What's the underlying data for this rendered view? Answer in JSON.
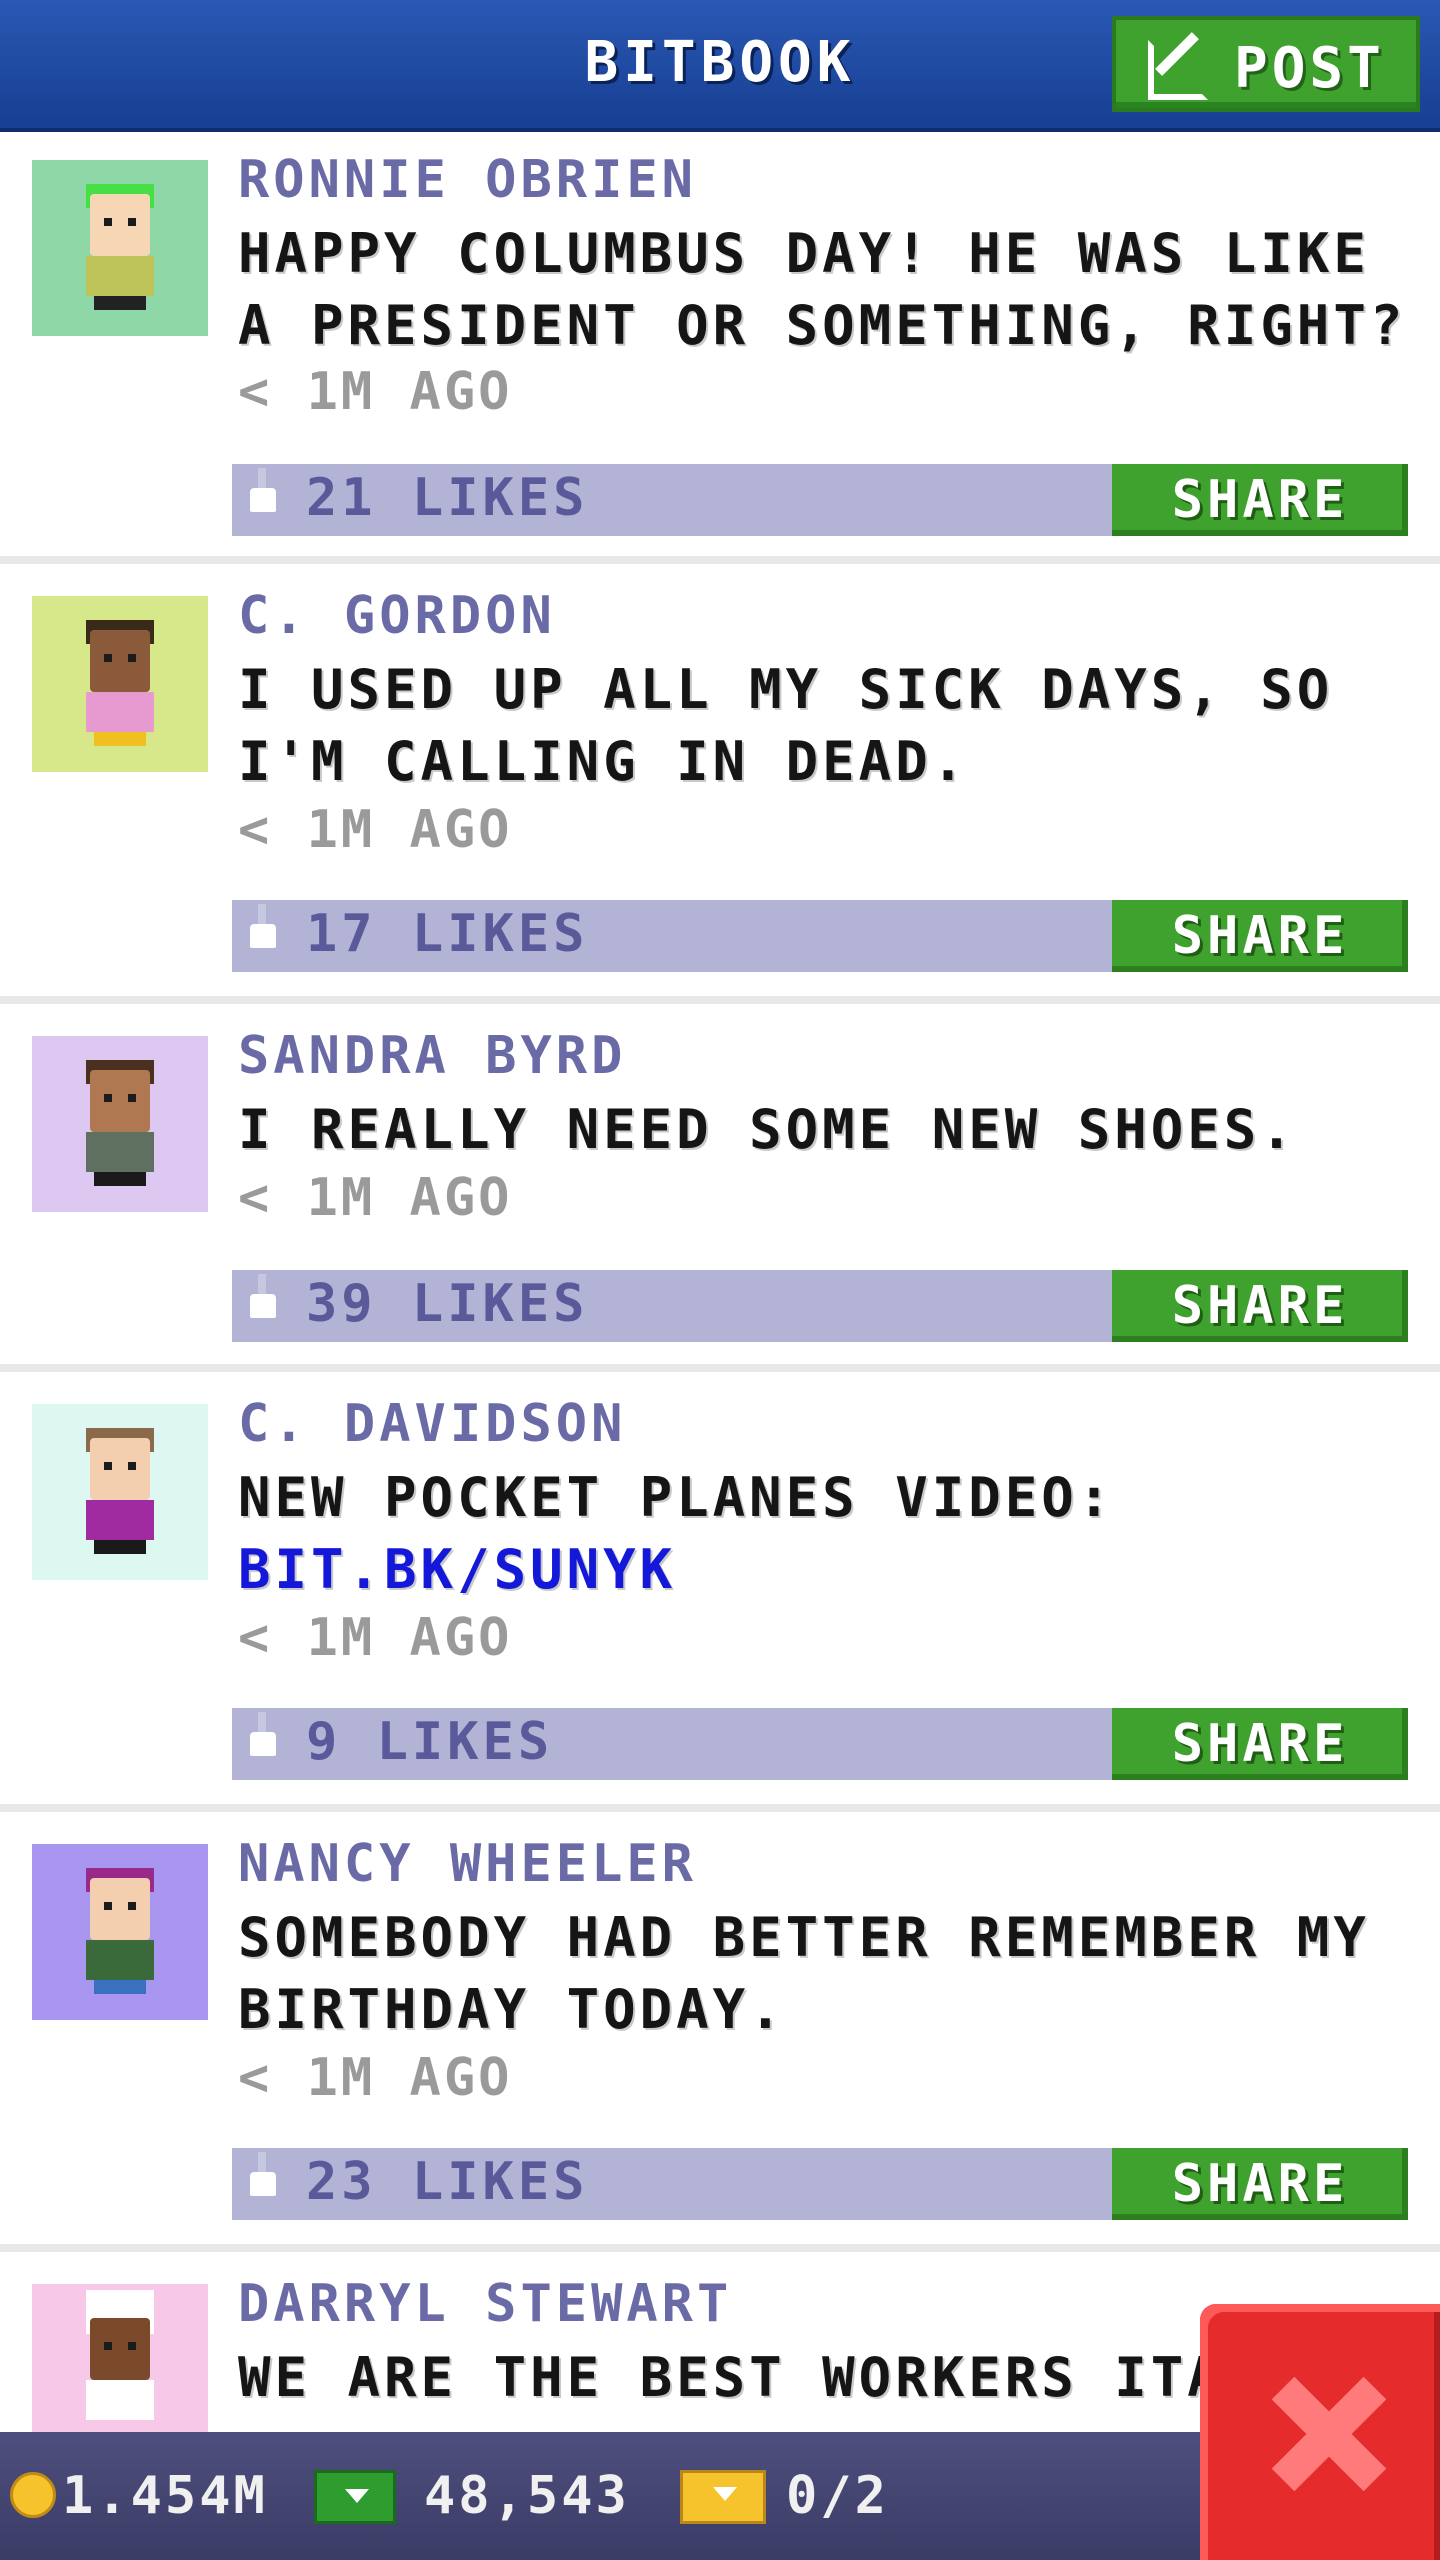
{
  "header": {
    "title": "BITBOOK",
    "post_label": "POST"
  },
  "posts": [
    {
      "name": "RONNIE OBRIEN",
      "message": "HAPPY COLUMBUS DAY! HE WAS LIKE A PRESIDENT OR SOMETHING, RIGHT?",
      "link": "",
      "time": "< 1M AGO",
      "likes": "21 LIKES",
      "share": "SHARE",
      "avatar_bg": "#8ed8a8"
    },
    {
      "name": "C. GORDON",
      "message": "I USED UP ALL MY SICK DAYS, SO I'M CALLING IN DEAD.",
      "link": "",
      "time": "< 1M AGO",
      "likes": "17 LIKES",
      "share": "SHARE",
      "avatar_bg": "#d6e88a"
    },
    {
      "name": "SANDRA BYRD",
      "message": "I REALLY NEED SOME NEW SHOES.",
      "link": "",
      "time": "< 1M AGO",
      "likes": "39 LIKES",
      "share": "SHARE",
      "avatar_bg": "#dcc8f0"
    },
    {
      "name": "C. DAVIDSON",
      "message": "NEW POCKET PLANES VIDEO:",
      "link": "BIT.BK/SUNYK",
      "time": "< 1M AGO",
      "likes": "9 LIKES",
      "share": "SHARE",
      "avatar_bg": "#dcf8f0"
    },
    {
      "name": "NANCY WHEELER",
      "message": "SOMEBODY HAD BETTER REMEMBER MY BIRTHDAY TODAY.",
      "link": "",
      "time": "< 1M AGO",
      "likes": "23 LIKES",
      "share": "SHARE",
      "avatar_bg": "#a896f0"
    },
    {
      "name": "DARRYL STEWART",
      "message": "WE ARE THE BEST WORKERS ITAL",
      "link": "",
      "time": "",
      "likes": "",
      "share": "",
      "avatar_bg": "#f8c8e8"
    }
  ],
  "status_bar": {
    "coins": "1.454M",
    "bux": "48,543",
    "tickets": "0/2"
  },
  "colors": {
    "header": "#1f4aa0",
    "share_green": "#3fa12e",
    "like_bar": "#b3b3d6",
    "close_red": "#e52b2b"
  }
}
